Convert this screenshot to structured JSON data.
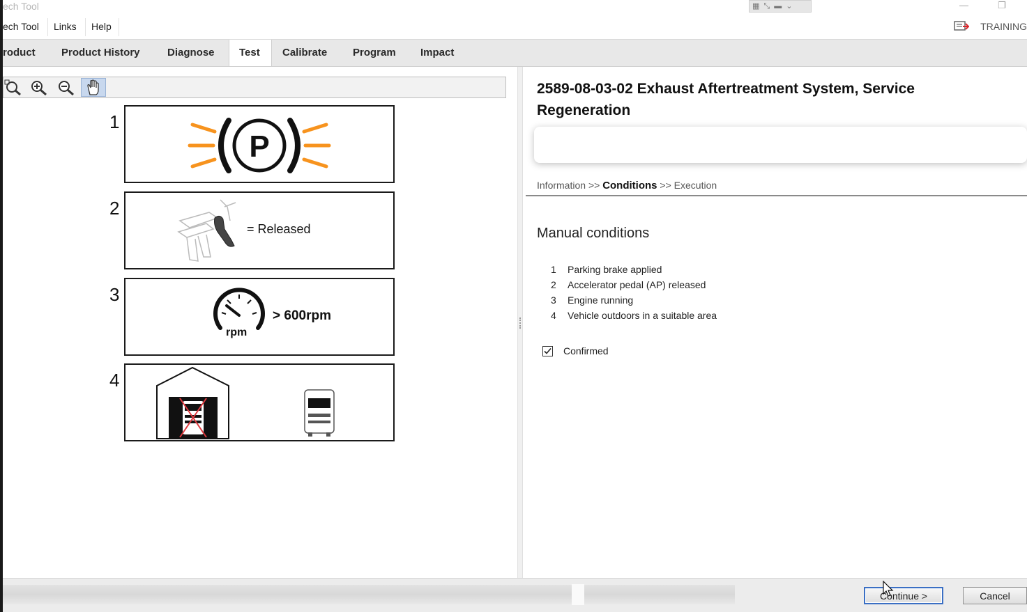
{
  "window": {
    "title": "ech Tool"
  },
  "menu": {
    "items": [
      "ech Tool",
      "Links",
      "Help"
    ],
    "training_label": "TRAINING"
  },
  "nav": {
    "tabs": [
      "roduct",
      "Product History",
      "Diagnose",
      "Test",
      "Calibrate",
      "Program",
      "Impact"
    ],
    "active": "Test"
  },
  "diagram": {
    "numbers": [
      "1",
      "2",
      "3",
      "4"
    ],
    "released_text": "= Released",
    "rpm_value": "> 600rpm",
    "rpm_label": "rpm",
    "parking_letter": "P"
  },
  "procedure": {
    "title": "2589-08-03-02 Exhaust Aftertreatment System, Service Regeneration",
    "breadcrumb": {
      "step1": "Information",
      "sep": ">>",
      "step2": "Conditions",
      "step3": "Execution"
    },
    "section_title": "Manual conditions",
    "conditions": [
      {
        "num": "1",
        "label": "Parking brake applied"
      },
      {
        "num": "2",
        "label": "Accelerator pedal (AP) released"
      },
      {
        "num": "3",
        "label": "Engine running"
      },
      {
        "num": "4",
        "label": "Vehicle outdoors in a suitable area"
      }
    ],
    "confirmed_label": "Confirmed",
    "confirmed": true
  },
  "footer": {
    "continue_label": "Continue >",
    "cancel_label": "Cancel"
  },
  "colors": {
    "accent_orange": "#f7931e",
    "button_focus": "#3a6fc4",
    "forbidden_red": "#e0393e"
  }
}
